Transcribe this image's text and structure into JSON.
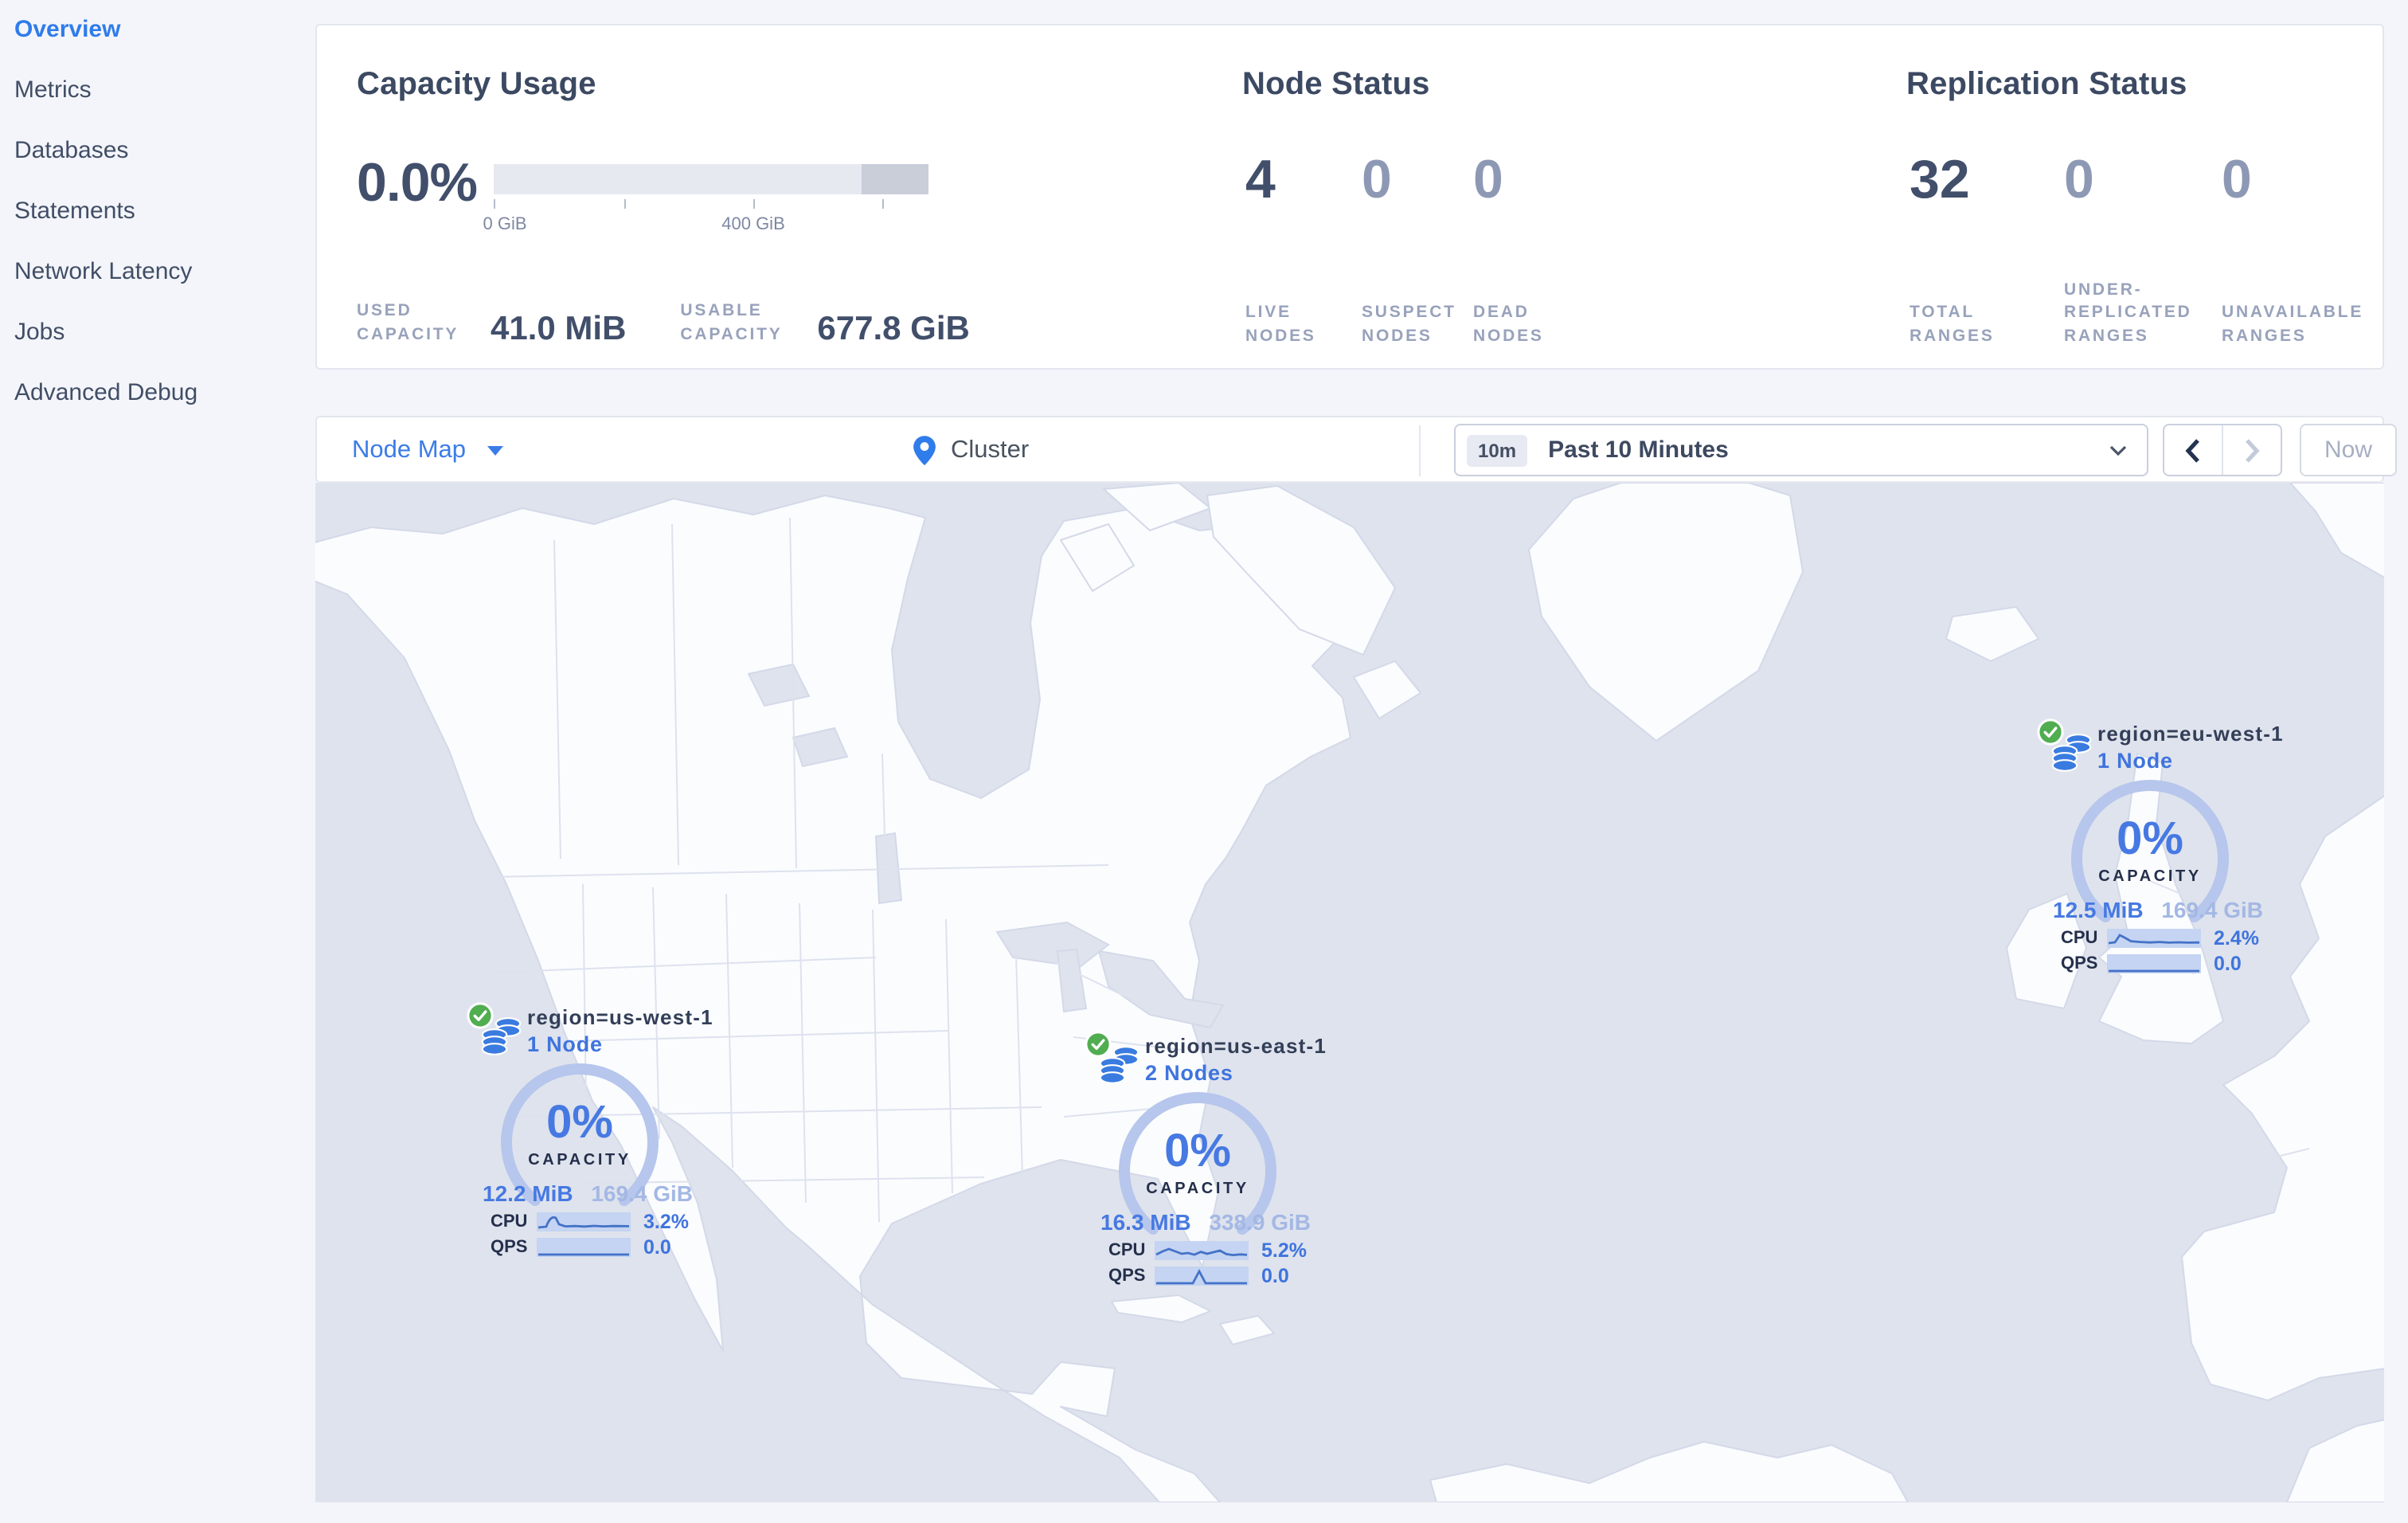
{
  "sidebar": {
    "items": [
      {
        "label": "Overview",
        "active": true
      },
      {
        "label": "Metrics",
        "active": false
      },
      {
        "label": "Databases",
        "active": false
      },
      {
        "label": "Statements",
        "active": false
      },
      {
        "label": "Network Latency",
        "active": false
      },
      {
        "label": "Jobs",
        "active": false
      },
      {
        "label": "Advanced Debug",
        "active": false
      }
    ]
  },
  "stats_panel": {
    "capacity": {
      "title": "Capacity Usage",
      "percent": "0.0%",
      "tick_label_zero": "0 GiB",
      "tick_label_mid": "400 GiB",
      "used_label": "USED CAPACITY",
      "used_value": "41.0 MiB",
      "usable_label": "USABLE CAPACITY",
      "usable_value": "677.8 GiB"
    },
    "node_status": {
      "title": "Node Status",
      "columns": [
        {
          "value": "4",
          "label": "LIVE NODES"
        },
        {
          "value": "0",
          "label": "SUSPECT NODES"
        },
        {
          "value": "0",
          "label": "DEAD NODES"
        }
      ]
    },
    "replication": {
      "title": "Replication Status",
      "columns": [
        {
          "value": "32",
          "label": "TOTAL RANGES"
        },
        {
          "value": "0",
          "label": "UNDER-REPLICATED RANGES"
        },
        {
          "value": "0",
          "label": "UNAVAILABLE RANGES"
        }
      ]
    }
  },
  "toolbar": {
    "view_selector": "Node Map",
    "breadcrumb": "Cluster",
    "time_window_badge": "10m",
    "time_window_label": "Past 10 Minutes",
    "now_button": "Now"
  },
  "map": {
    "regions": [
      {
        "name": "region=us-west-1",
        "nodes": "1 Node",
        "capacity_percent": "0%",
        "capacity_label": "CAPACITY",
        "used": "12.2 MiB",
        "total": "169.4 GiB",
        "cpu_label": "CPU",
        "cpu_value": "3.2%",
        "qps_label": "QPS",
        "qps_value": "0.0"
      },
      {
        "name": "region=us-east-1",
        "nodes": "2 Nodes",
        "capacity_percent": "0%",
        "capacity_label": "CAPACITY",
        "used": "16.3 MiB",
        "total": "338.9 GiB",
        "cpu_label": "CPU",
        "cpu_value": "5.2%",
        "qps_label": "QPS",
        "qps_value": "0.0"
      },
      {
        "name": "region=eu-west-1",
        "nodes": "1 Node",
        "capacity_percent": "0%",
        "capacity_label": "CAPACITY",
        "used": "12.5 MiB",
        "total": "169.4 GiB",
        "cpu_label": "CPU",
        "cpu_value": "2.4%",
        "qps_label": "QPS",
        "qps_value": "0.0"
      }
    ]
  },
  "colors": {
    "accent_blue": "#3b7ce8",
    "marker_blue": "#3f74dd",
    "ring_periwinkle": "#b6c6ec",
    "ocean": "#dfe3ed",
    "land": "#fbfcfe",
    "status_green": "#50ad50",
    "dark_text": "#414f6b",
    "muted_label": "#98a2bb"
  }
}
